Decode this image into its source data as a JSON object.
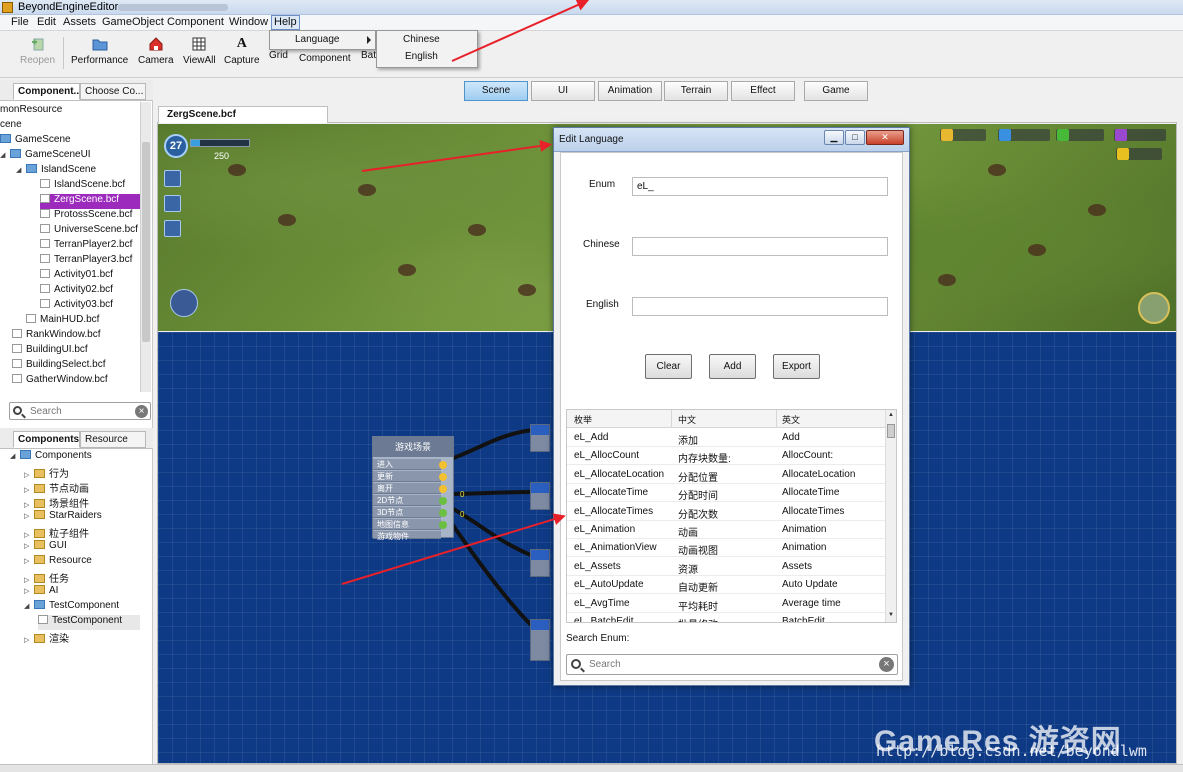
{
  "app": {
    "title": "BeyondEngineEditor"
  },
  "menu": [
    "File",
    "Edit",
    "Assets",
    "GameObject",
    "Component",
    "Window",
    "Help"
  ],
  "toolbar": [
    "Reopen",
    "Performance",
    "Camera",
    "ViewAll",
    "Capture",
    "Grid",
    "Component",
    "Bat"
  ],
  "help_menu": {
    "item": "Language",
    "submenu": [
      "Chinese",
      "English"
    ]
  },
  "left_top_tabs": [
    "Component...",
    "Choose Co..."
  ],
  "left_tree": [
    "monResource",
    "cene",
    "GameScene",
    "GameSceneUI",
    "IslandScene",
    "IslandScene.bcf",
    "ZergScene.bcf",
    "ProtossScene.bcf",
    "UniverseScene.bcf",
    "TerranPlayer2.bcf",
    "TerranPlayer3.bcf",
    "Activity01.bcf",
    "Activity02.bcf",
    "Activity03.bcf",
    "MainHUD.bcf",
    "RankWindow.bcf",
    "BuildingUI.bcf",
    "BuildingSelect.bcf",
    "GatherWindow.bcf"
  ],
  "left_search_placeholder": "Search",
  "left_bottom_tabs": [
    "Components",
    "Resource"
  ],
  "components_tree": [
    "Components",
    "行为",
    "节点动画",
    "场景组件",
    "StarRaiders",
    "粒子组件",
    "GUI",
    "Resource",
    "任务",
    "AI",
    "TestComponent",
    "TestComponent",
    "渲染"
  ],
  "scene_tabs": [
    "Scene",
    "UI",
    "Animation",
    "Terrain",
    "Effect",
    "Game"
  ],
  "doc_tab": "ZergScene.bcf",
  "game_hud": {
    "level": "27",
    "gold": "250"
  },
  "node": {
    "title": "游戏场景",
    "ports": [
      "进入",
      "更新",
      "离开",
      "2D节点",
      "3D节点",
      "地图信息",
      "游戏物件"
    ],
    "values": [
      "0",
      "0"
    ]
  },
  "dialog": {
    "title": "Edit Language",
    "labels": {
      "enum": "Enum",
      "chinese": "Chinese",
      "english": "English"
    },
    "values": {
      "enum": "eL_",
      "chinese": "",
      "english": ""
    },
    "buttons": [
      "Clear",
      "Add",
      "Export"
    ],
    "columns": [
      "枚举",
      "中文",
      "英文"
    ],
    "rows": [
      [
        "eL_Add",
        "添加",
        "Add"
      ],
      [
        "eL_AllocCount",
        "内存块数量:",
        "AllocCount:"
      ],
      [
        "eL_AllocateLocation",
        "分配位置",
        "AllocateLocation"
      ],
      [
        "eL_AllocateTime",
        "分配时间",
        "AllocateTime"
      ],
      [
        "eL_AllocateTimes",
        "分配次数",
        "AllocateTimes"
      ],
      [
        "eL_Animation",
        "动画",
        "Animation"
      ],
      [
        "eL_AnimationView",
        "动画视图",
        "Animation"
      ],
      [
        "eL_Assets",
        "资源",
        "Assets"
      ],
      [
        "eL_AutoUpdate",
        "自动更新",
        "Auto Update"
      ],
      [
        "eL_AvgTime",
        "平均耗时",
        "Average time"
      ],
      [
        "eL_BatchEdit",
        "批量修改",
        "BatchEdit"
      ]
    ],
    "search_label": "Search Enum:",
    "search_placeholder": "Search"
  },
  "watermark": {
    "brand": "GameRes 游资网",
    "url": "http://blog.csdn.net/beyondlwm"
  },
  "colors": {
    "selection": "#9c2bbd",
    "scene_selected": "#9fcdf1",
    "node_grid": "#0e3a85",
    "arrow": "#e8202a"
  }
}
